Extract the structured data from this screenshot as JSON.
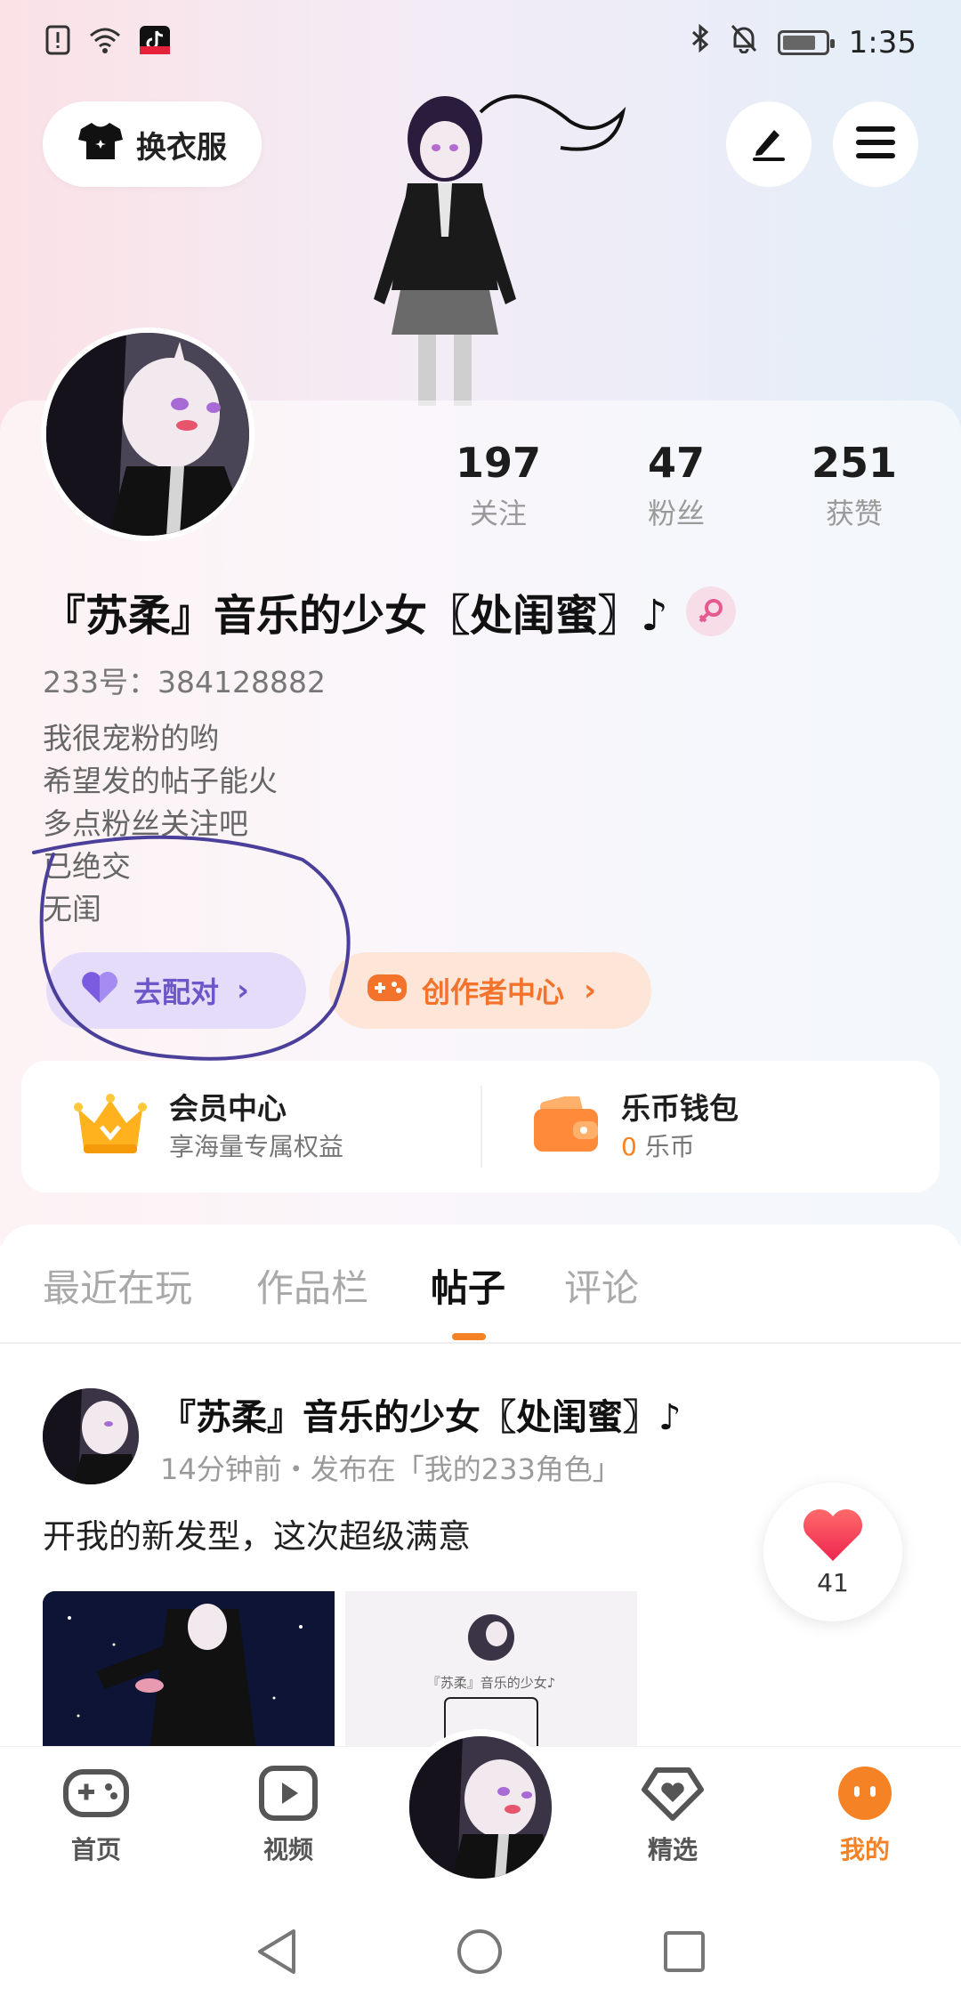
{
  "status_bar": {
    "time": "1:35",
    "left_icons": [
      "alert-icon",
      "wifi-icon",
      "tiktok-icon"
    ],
    "right_icons": [
      "bluetooth-icon",
      "mute-icon",
      "battery-icon"
    ]
  },
  "header": {
    "outfit_label": "换衣服",
    "icons": [
      "shirt-icon",
      "edit-icon",
      "menu-icon"
    ]
  },
  "stats": [
    {
      "value": "197",
      "label": "关注"
    },
    {
      "value": "47",
      "label": "粉丝"
    },
    {
      "value": "251",
      "label": "获赞"
    }
  ],
  "profile": {
    "nickname": "『苏柔』音乐的少女〖处闺蜜〗♪",
    "gender_icon": "female-icon",
    "uid": "233号：384128882",
    "bio": [
      "我很宠粉的哟",
      "希望发的帖子能火",
      "多点粉丝关注吧",
      "已绝交",
      "无闺"
    ]
  },
  "actions": {
    "pair_label": "去配对",
    "creator_label": "创作者中心",
    "chevron": "›"
  },
  "wallet_card": {
    "vip_title": "会员中心",
    "vip_sub": "享海量专属权益",
    "wallet_title": "乐币钱包",
    "coin_amount": "0",
    "coin_unit": "乐币"
  },
  "tabs": [
    {
      "label": "最近在玩",
      "active": false
    },
    {
      "label": "作品栏",
      "active": false
    },
    {
      "label": "帖子",
      "active": true
    },
    {
      "label": "评论",
      "active": false
    }
  ],
  "post": {
    "author": "『苏柔』音乐的少女〖处闺蜜〗♪",
    "meta": "14分钟前・发布在「我的233角色」",
    "text": "开我的新发型，这次超级满意",
    "image2_caption": "『苏柔』音乐的少女♪",
    "like_count": "41"
  },
  "bottom_nav": [
    {
      "label": "首页",
      "icon": "gamepad-icon"
    },
    {
      "label": "视频",
      "icon": "play-icon"
    },
    {
      "label": "精选",
      "icon": "heart-diamond-icon"
    },
    {
      "label": "我的",
      "icon": "face-icon",
      "active": true
    }
  ],
  "colors": {
    "accent": "#f58225",
    "pair_purple": "#6b57c9",
    "annotation": "#4a3f9a"
  }
}
